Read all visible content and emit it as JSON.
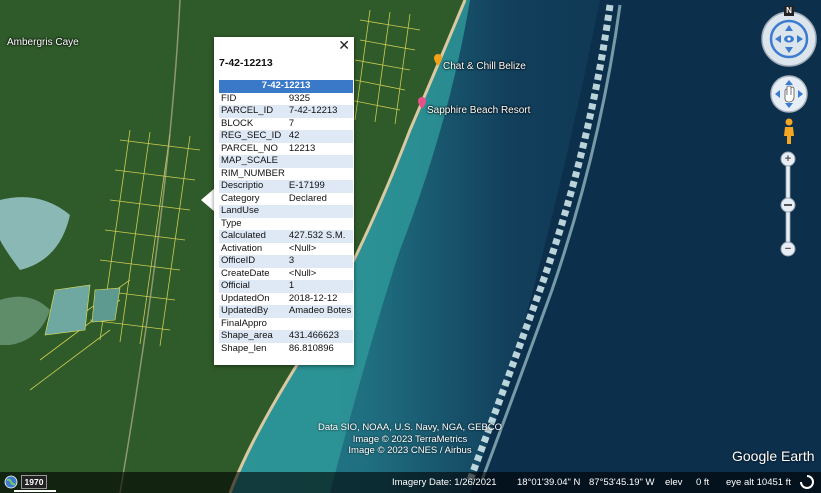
{
  "map": {
    "labels": {
      "island": "Ambergris Caye",
      "poi1": "Chat & Chill Belize",
      "poi2": "Sapphire Beach Resort"
    },
    "colors": {
      "land": "#2f5a2a",
      "ocean_deep": "#0e3550",
      "ocean_shallow": "#3aa6a8",
      "reef": "#bfe3e6",
      "parcel_lines": "#e8e25a",
      "poi_orange": "#f2a21a",
      "poi_pink": "#e8508a"
    }
  },
  "popup": {
    "title": "7-42-12213",
    "close_label": "✕",
    "header": "7-42-12213",
    "rows": [
      {
        "key": "FID",
        "value": "9325"
      },
      {
        "key": "PARCEL_ID",
        "value": "7-42-12213"
      },
      {
        "key": "BLOCK",
        "value": "7"
      },
      {
        "key": "REG_SEC_ID",
        "value": "42"
      },
      {
        "key": "PARCEL_NO",
        "value": "12213"
      },
      {
        "key": "MAP_SCALE",
        "value": ""
      },
      {
        "key": "RIM_NUMBER",
        "value": ""
      },
      {
        "key": "Descriptio",
        "value": "E-17199"
      },
      {
        "key": "Category",
        "value": "Declared"
      },
      {
        "key": "LandUse",
        "value": ""
      },
      {
        "key": "Type",
        "value": ""
      },
      {
        "key": "Calculated",
        "value": "427.532 S.M."
      },
      {
        "key": "Activation",
        "value": "<Null>"
      },
      {
        "key": "OfficeID",
        "value": "3"
      },
      {
        "key": "CreateDate",
        "value": "<Null>"
      },
      {
        "key": "Official",
        "value": "1"
      },
      {
        "key": "UpdatedOn",
        "value": "2018-12-12"
      },
      {
        "key": "UpdatedBy",
        "value": "Amadeo Botes"
      },
      {
        "key": "FinalAppro",
        "value": ""
      },
      {
        "key": "Shape_area",
        "value": "431.466623"
      },
      {
        "key": "Shape_len",
        "value": "86.810896"
      }
    ]
  },
  "navigation": {
    "compass_north": "N",
    "zoom_in": "+",
    "zoom_out": "−"
  },
  "attribution": {
    "line1": "Data SIO, NOAA, U.S. Navy, NGA, GEBCO",
    "line2": "Image © 2023 TerraMetrics",
    "line3": "Image © 2023 CNES / Airbus"
  },
  "logo": "Google Earth",
  "status": {
    "year": "1970",
    "imagery_date": "Imagery Date: 1/26/2021",
    "lat": "18°01'39.04\" N",
    "lon": "87°53'45.19\" W",
    "elev_label": "elev",
    "elev_value": "0 ft",
    "eye_alt": "eye alt  10451 ft"
  }
}
